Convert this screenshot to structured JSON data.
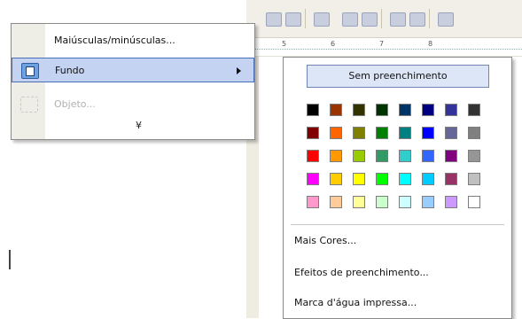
{
  "menu": {
    "items": [
      {
        "label": "Maiúsculas/minúsculas...",
        "icon": "",
        "enabled": true
      },
      {
        "label": "Fundo",
        "icon": "background-icon",
        "enabled": true,
        "has_submenu": true,
        "highlighted": true
      },
      {
        "label": "Objeto...",
        "icon": "object-icon",
        "enabled": false
      }
    ],
    "expand_glyph": "¥"
  },
  "submenu": {
    "no_fill": "Sem preenchimento",
    "colors": [
      [
        "#000000",
        "#993300",
        "#333300",
        "#003300",
        "#003366",
        "#000080",
        "#333399",
        "#333333"
      ],
      [
        "#800000",
        "#ff6600",
        "#808000",
        "#008000",
        "#008080",
        "#0000ff",
        "#666699",
        "#808080"
      ],
      [
        "#ff0000",
        "#ff9900",
        "#99cc00",
        "#339966",
        "#33cccc",
        "#3366ff",
        "#800080",
        "#969696"
      ],
      [
        "#ff00ff",
        "#ffcc00",
        "#ffff00",
        "#00ff00",
        "#00ffff",
        "#00ccff",
        "#993366",
        "#c0c0c0"
      ],
      [
        "#ff99cc",
        "#ffcc99",
        "#ffff99",
        "#ccffcc",
        "#ccffff",
        "#99ccff",
        "#cc99ff",
        "#ffffff"
      ]
    ],
    "more_colors": "Mais Cores...",
    "fill_effects": "Efeitos de preenchimento...",
    "watermark": "Marca d'água impressa..."
  },
  "ruler": {
    "numbers": [
      "5",
      "6",
      "7",
      "8"
    ]
  },
  "colors": {
    "highlight": "#c5d3f2",
    "highlight_border": "#4c6eb8"
  }
}
